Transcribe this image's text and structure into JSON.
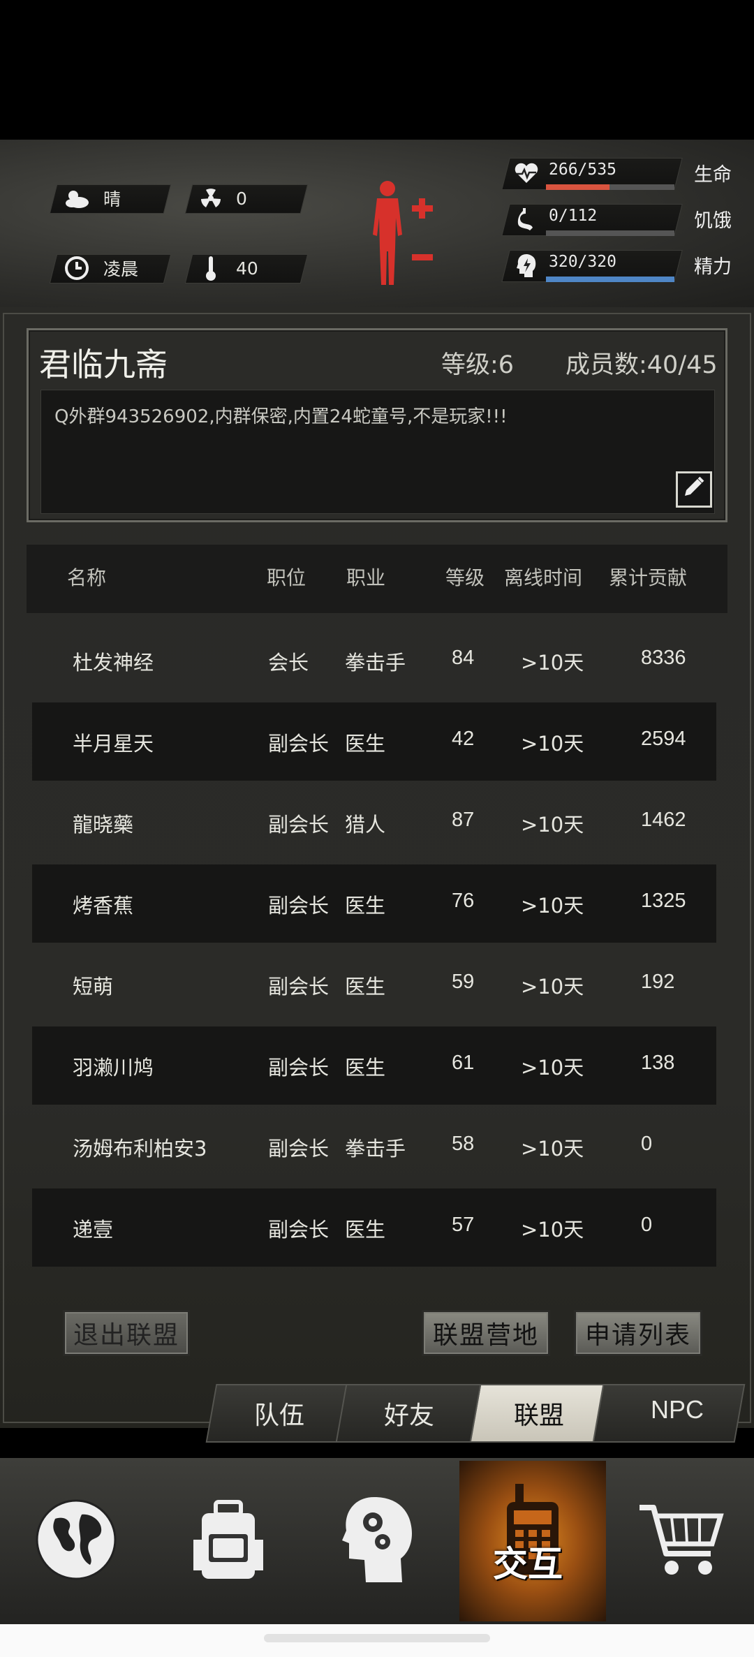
{
  "status": {
    "weather": {
      "icon": "cloud-sun-icon",
      "value": "晴"
    },
    "radiation": {
      "icon": "radiation-icon",
      "value": "0"
    },
    "time": {
      "icon": "clock-icon",
      "value": "凌晨"
    },
    "temperature": {
      "icon": "thermometer-icon",
      "value": "40"
    },
    "life": {
      "icon": "heart-pulse-icon",
      "value": "266/535",
      "label": "生命",
      "fraction": 0.497,
      "color": "#d9543f"
    },
    "hunger": {
      "icon": "stomach-icon",
      "value": "0/112",
      "label": "饥饿",
      "fraction": 0.0,
      "color": "#c9a040"
    },
    "energy": {
      "icon": "energy-head-icon",
      "value": "320/320",
      "label": "精力",
      "fraction": 1.0,
      "color": "#4f86c6"
    }
  },
  "guild": {
    "name": "君临九斋",
    "level": "等级:6",
    "members": "成员数:40/45",
    "notice": "Q外群943526902,内群保密,内置24蛇童号,不是玩家!!!"
  },
  "table": {
    "headers": [
      "名称",
      "职位",
      "职业",
      "等级",
      "离线时间",
      "累计贡献"
    ],
    "rows": [
      {
        "name": "杜发神经",
        "position": "会长",
        "job": "拳击手",
        "level": "84",
        "offline": ">10天",
        "contribution": "8336"
      },
      {
        "name": "半月星天",
        "position": "副会长",
        "job": "医生",
        "level": "42",
        "offline": ">10天",
        "contribution": "2594"
      },
      {
        "name": "龍晓藥",
        "position": "副会长",
        "job": "猎人",
        "level": "87",
        "offline": ">10天",
        "contribution": "1462"
      },
      {
        "name": "烤香蕉",
        "position": "副会长",
        "job": "医生",
        "level": "76",
        "offline": ">10天",
        "contribution": "1325"
      },
      {
        "name": "短萌",
        "position": "副会长",
        "job": "医生",
        "level": "59",
        "offline": ">10天",
        "contribution": "192"
      },
      {
        "name": "羽濑川鸠",
        "position": "副会长",
        "job": "医生",
        "level": "61",
        "offline": ">10天",
        "contribution": "138"
      },
      {
        "name": "汤姆布利柏安3",
        "position": "副会长",
        "job": "拳击手",
        "level": "58",
        "offline": ">10天",
        "contribution": "0"
      },
      {
        "name": "递壹",
        "position": "副会长",
        "job": "医生",
        "level": "57",
        "offline": ">10天",
        "contribution": "0"
      }
    ]
  },
  "buttons": {
    "leave": "退出联盟",
    "camp": "联盟营地",
    "applications": "申请列表"
  },
  "tabs": [
    {
      "label": "队伍",
      "active": false
    },
    {
      "label": "好友",
      "active": false
    },
    {
      "label": "联盟",
      "active": true
    },
    {
      "label": "NPC",
      "active": false
    }
  ],
  "nav": {
    "map": "globe-icon",
    "backpack": "backpack-icon",
    "skills": "head-gears-icon",
    "interact": {
      "icon": "walkie-talkie-icon",
      "label": "交互"
    },
    "shop": "shopping-cart-icon"
  }
}
